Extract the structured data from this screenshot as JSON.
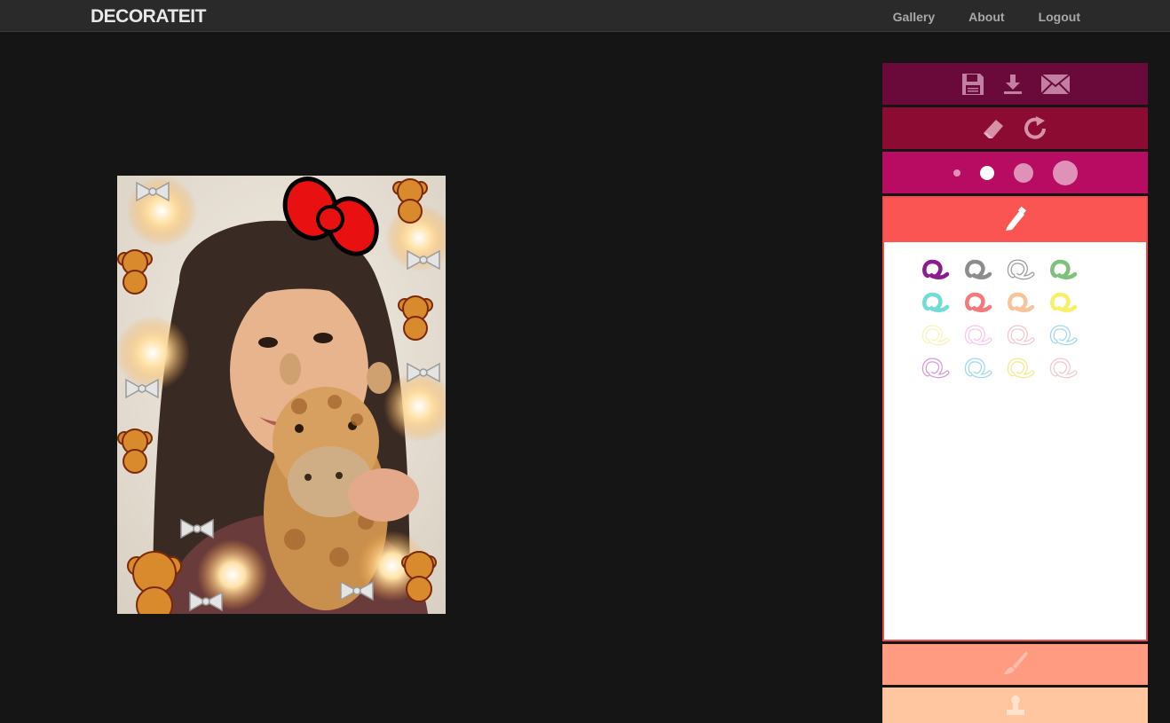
{
  "app": {
    "brand": "DECORATEIT"
  },
  "nav": {
    "links": [
      {
        "label": "Gallery"
      },
      {
        "label": "About"
      },
      {
        "label": "Logout"
      }
    ]
  },
  "toolbar": {
    "actions": [
      {
        "icon": "floppy-disk-icon"
      },
      {
        "icon": "download-icon"
      },
      {
        "icon": "envelope-icon"
      }
    ],
    "edit": [
      {
        "icon": "eraser-icon"
      },
      {
        "icon": "redo-icon"
      }
    ],
    "brush_sizes": {
      "selected": 2,
      "count": 4
    }
  },
  "palette": {
    "header_icon": "pencil-icon",
    "swatch_colors": [
      "#8b1b8f",
      "#8c8c8c",
      "#9a9a9a",
      "#7cc27a",
      "#6fdcd5",
      "#f2787a",
      "#f8c39a",
      "#f6f06a",
      "#f6f4b8",
      "#f4c6f2",
      "#f4c6cc",
      "#9fd8f0",
      "#d79ad8",
      "#9fd8ee",
      "#f3ea8a",
      "#f0c8d0"
    ],
    "outline_rows": [
      2,
      3
    ]
  },
  "sections": [
    {
      "icon": "paintbrush-icon",
      "color": "#ff9b80"
    },
    {
      "icon": "stamp-icon",
      "color": "#ffc6a0"
    }
  ],
  "colors": {
    "navbar": "#2a2a2a",
    "background": "#151515",
    "panel_row1": "#6a0a3a",
    "panel_row2": "#8c0b33",
    "panel_row3": "#b80c62",
    "marker": "#fb5553"
  }
}
